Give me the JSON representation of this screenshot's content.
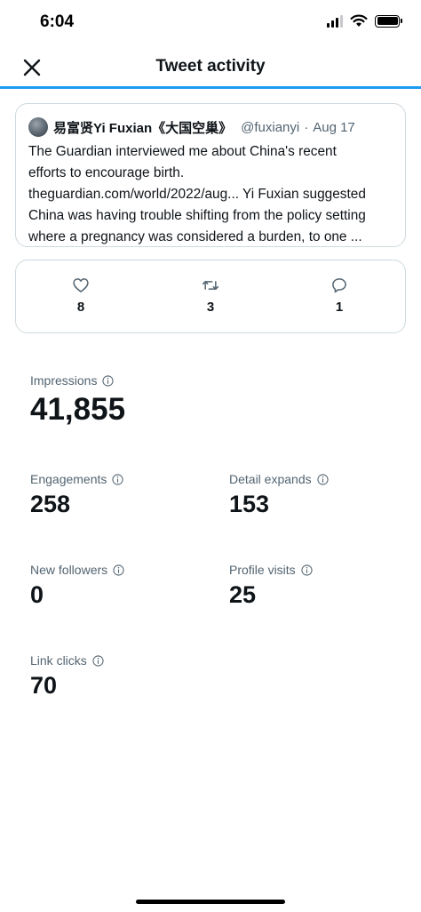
{
  "status_bar": {
    "time": "6:04"
  },
  "header": {
    "title": "Tweet activity"
  },
  "tweet": {
    "author_name": "易富贤Yi Fuxian《大国空巢》",
    "handle": "@fuxianyi",
    "separator": "·",
    "date": "Aug 17",
    "lines": [
      "The Guardian interviewed me about China's recent",
      "efforts to encourage birth.",
      "theguardian.com/world/2022/aug... Yi Fuxian suggested",
      "China  was having trouble shifting from the policy setting",
      "where a pregnancy was considered a burden, to one ..."
    ]
  },
  "engagement": {
    "likes": "8",
    "retweets": "3",
    "replies": "1"
  },
  "metrics": {
    "impressions": {
      "label": "Impressions",
      "value": "41,855"
    },
    "engagements": {
      "label": "Engagements",
      "value": "258"
    },
    "detail_expands": {
      "label": "Detail expands",
      "value": "153"
    },
    "new_followers": {
      "label": "New followers",
      "value": "0"
    },
    "profile_visits": {
      "label": "Profile visits",
      "value": "25"
    },
    "link_clicks": {
      "label": "Link clicks",
      "value": "70"
    }
  },
  "colors": {
    "accent": "#1d9bf0",
    "secondary_text": "#536471",
    "border": "#cfd9de"
  }
}
